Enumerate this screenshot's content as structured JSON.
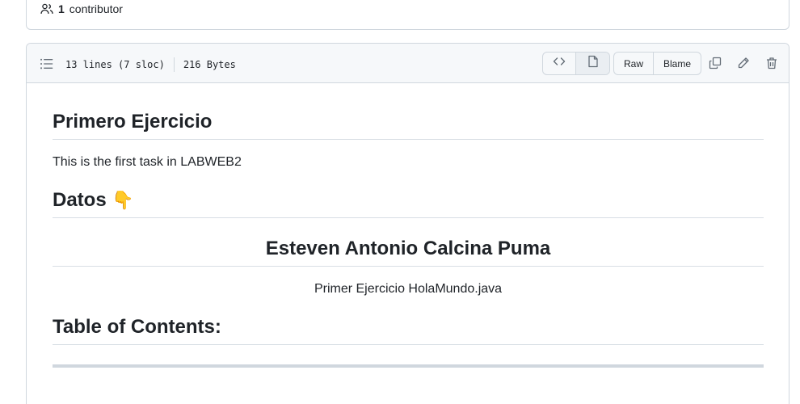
{
  "contributors": {
    "count": "1",
    "label": "contributor"
  },
  "file_header": {
    "lines": "13 lines (7 sloc)",
    "size": "216 Bytes",
    "buttons": {
      "raw": "Raw",
      "blame": "Blame"
    },
    "icons": [
      "list-unordered-icon",
      "code-icon",
      "file-icon",
      "copy-icon",
      "pencil-icon",
      "trash-icon"
    ]
  },
  "readme": {
    "heading1": "Primero Ejercicio",
    "paragraph1": "This is the first task in LABWEB2",
    "heading2": "Datos",
    "heading2_emoji": "👇",
    "author_heading": "Esteven Antonio Calcina Puma",
    "exercise_line": "Primer Ejercicio HolaMundo.java",
    "toc_heading": "Table of Contents:"
  },
  "colors": {
    "border": "#d0d7de",
    "header_bg": "#f6f8fa",
    "text": "#1f2328",
    "icon": "#636c76"
  }
}
